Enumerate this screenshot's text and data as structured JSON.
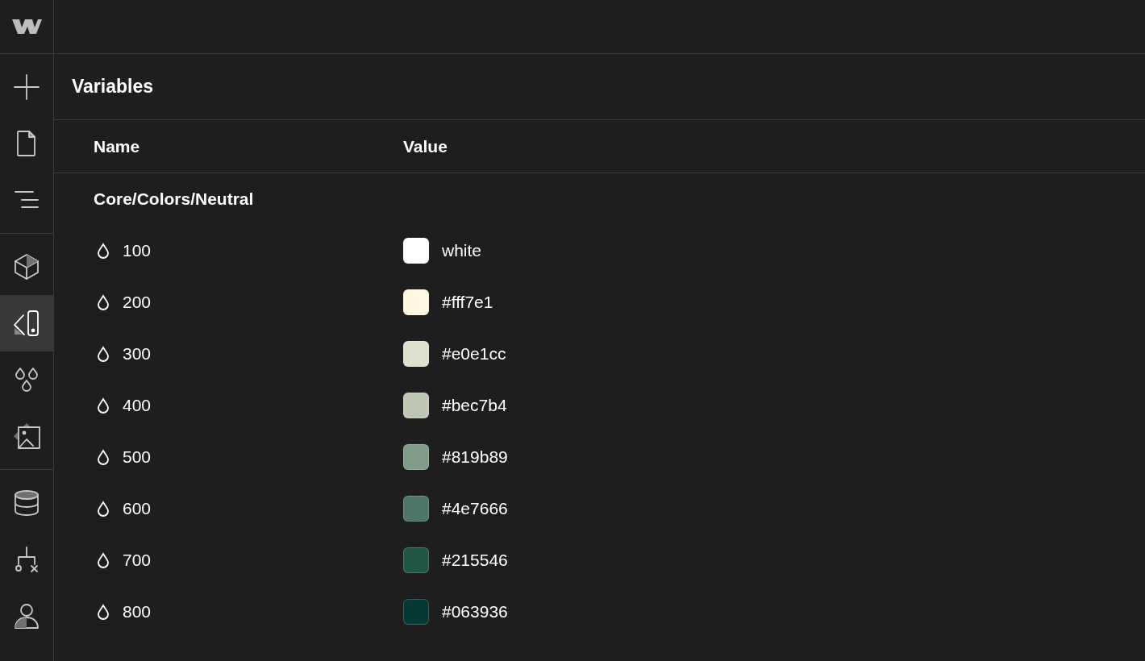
{
  "sidebar": {
    "groups": [
      {
        "items": [
          {
            "kind": "add",
            "selected": false
          },
          {
            "kind": "page",
            "selected": false
          },
          {
            "kind": "navigator",
            "selected": false
          }
        ]
      },
      {
        "items": [
          {
            "kind": "components",
            "selected": false
          },
          {
            "kind": "variables",
            "selected": true
          },
          {
            "kind": "swatches",
            "selected": false
          },
          {
            "kind": "assets",
            "selected": false
          }
        ]
      },
      {
        "items": [
          {
            "kind": "cms",
            "selected": false
          },
          {
            "kind": "logic",
            "selected": false
          },
          {
            "kind": "users",
            "selected": false
          }
        ]
      }
    ]
  },
  "panel": {
    "title": "Variables",
    "columns": [
      "Name",
      "Value"
    ],
    "groups": [
      {
        "name": "Core/Colors/Neutral",
        "variables": [
          {
            "name": "100",
            "value": "white",
            "color": "#ffffff"
          },
          {
            "name": "200",
            "value": "#fff7e1",
            "color": "#fff7e1"
          },
          {
            "name": "300",
            "value": "#e0e1cc",
            "color": "#e0e1cc"
          },
          {
            "name": "400",
            "value": "#bec7b4",
            "color": "#bec7b4"
          },
          {
            "name": "500",
            "value": "#819b89",
            "color": "#819b89"
          },
          {
            "name": "600",
            "value": "#4e7666",
            "color": "#4e7666"
          },
          {
            "name": "700",
            "value": "#215546",
            "color": "#215546"
          },
          {
            "name": "800",
            "value": "#063936",
            "color": "#063936"
          }
        ]
      }
    ]
  }
}
